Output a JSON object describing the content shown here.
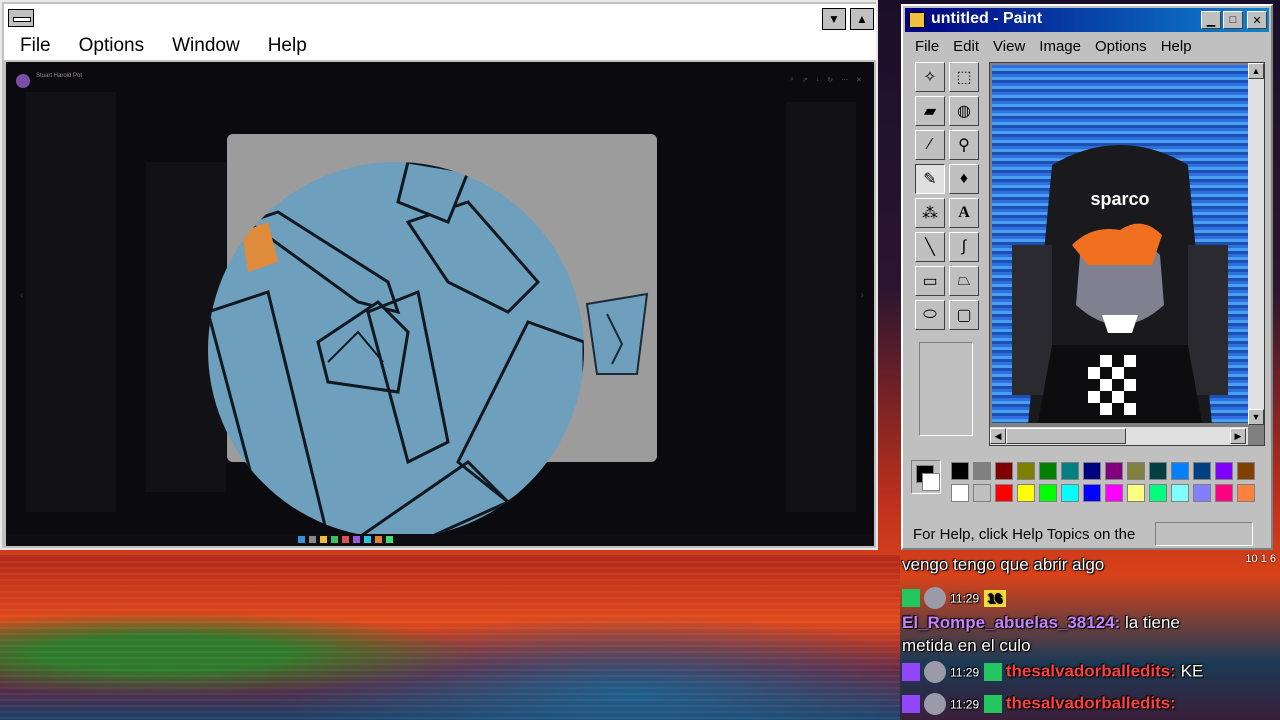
{
  "left_window": {
    "menu": [
      "File",
      "Options",
      "Window",
      "Help"
    ],
    "viewer_user": "Stuart Harold Pot",
    "title_buttons": {
      "minimize": "▼",
      "maximize": "▲"
    }
  },
  "paint": {
    "title": "untitled - Paint",
    "menu": [
      "File",
      "Edit",
      "View",
      "Image",
      "Options",
      "Help"
    ],
    "status_text": "For Help, click Help Topics on the",
    "tools": [
      "free-select",
      "rect-select",
      "eraser",
      "fill",
      "color-picker",
      "magnifier",
      "pencil",
      "brush",
      "airbrush",
      "text",
      "line",
      "curve",
      "rectangle",
      "polygon",
      "ellipse",
      "rounded-rect"
    ],
    "palette_row1": [
      "#000000",
      "#808080",
      "#800000",
      "#808000",
      "#008000",
      "#008080",
      "#000080",
      "#800080",
      "#808040",
      "#004040",
      "#0080ff",
      "#004080",
      "#8000ff",
      "#804000"
    ],
    "palette_row2": [
      "#ffffff",
      "#c0c0c0",
      "#ff0000",
      "#ffff00",
      "#00ff00",
      "#00ffff",
      "#0000ff",
      "#ff00ff",
      "#ffff80",
      "#00ff80",
      "#80ffff",
      "#8080ff",
      "#ff0080",
      "#ff8040"
    ],
    "canvas_brand": "sparco"
  },
  "chat": {
    "line1": "vengo tengo que abrir algo",
    "viewer_counts": "10  1  6",
    "time1": "11:29",
    "count": "16",
    "user1": "El_Rompe_abuelas_38124:",
    "msg1a": "la tiene",
    "msg1b": "metida en el culo",
    "time2": "11:29",
    "user2": "thesalvadorballedits:",
    "msg2": "KE",
    "time3": "11:29",
    "user3": "thesalvadorballedits:"
  }
}
